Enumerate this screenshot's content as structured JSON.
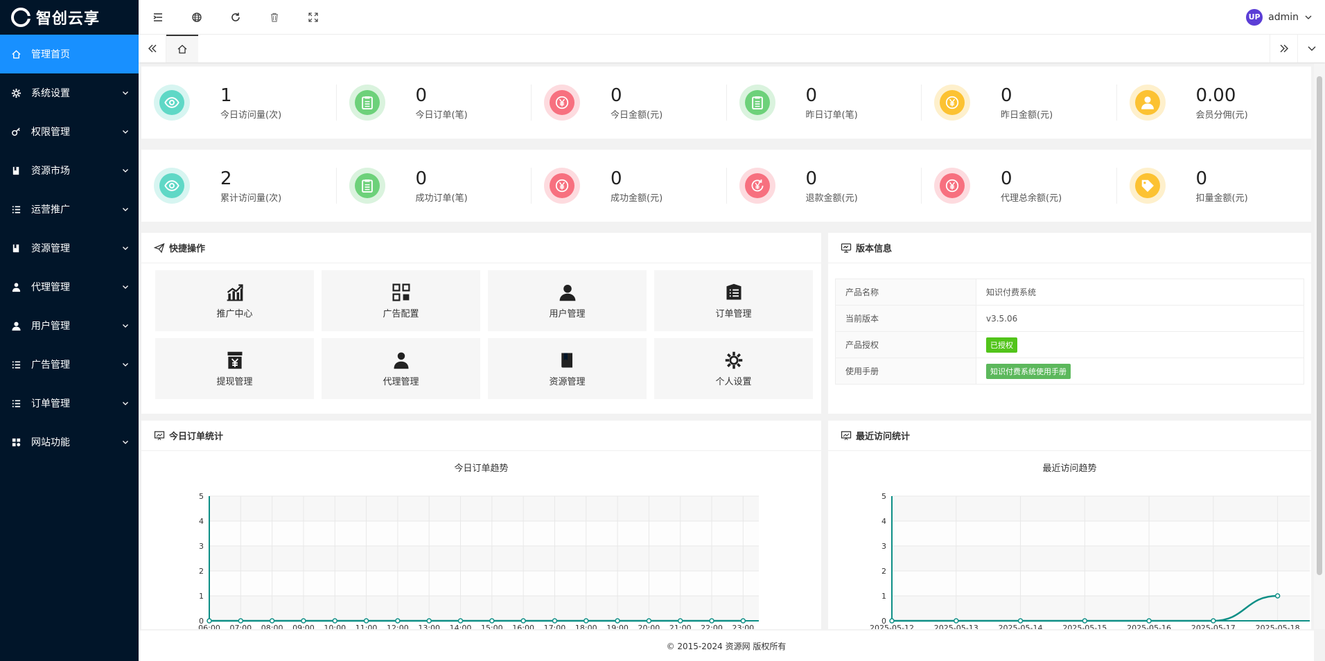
{
  "brand": {
    "name": "智创云享"
  },
  "sidebar": {
    "items": [
      {
        "label": "管理首页",
        "icon": "home-icon",
        "active": true
      },
      {
        "label": "系统设置",
        "icon": "gear-icon"
      },
      {
        "label": "权限管理",
        "icon": "key-icon"
      },
      {
        "label": "资源市场",
        "icon": "book-icon"
      },
      {
        "label": "运营推广",
        "icon": "list-icon"
      },
      {
        "label": "资源管理",
        "icon": "book-icon"
      },
      {
        "label": "代理管理",
        "icon": "agent-icon"
      },
      {
        "label": "用户管理",
        "icon": "user-icon"
      },
      {
        "label": "广告管理",
        "icon": "list-icon"
      },
      {
        "label": "订单管理",
        "icon": "list-icon"
      },
      {
        "label": "网站功能",
        "icon": "grid-icon"
      }
    ]
  },
  "header": {
    "user": "admin",
    "avatar_text": "UP"
  },
  "stats_row1": [
    {
      "value": "1",
      "label": "今日访问量(次)",
      "icon": "eye-icon",
      "color": "#5fd8c6"
    },
    {
      "value": "0",
      "label": "今日订单(笔)",
      "icon": "clipboard-icon",
      "color": "#6dd17a"
    },
    {
      "value": "0",
      "label": "今日金额(元)",
      "icon": "yuan-icon",
      "color": "#f7707f"
    },
    {
      "value": "0",
      "label": "昨日订单(笔)",
      "icon": "clipboard-icon",
      "color": "#6dd17a"
    },
    {
      "value": "0",
      "label": "昨日金额(元)",
      "icon": "yuan-icon",
      "color": "#fcc232"
    },
    {
      "value": "0.00",
      "label": "会员分佣(元)",
      "icon": "user-icon",
      "color": "#fcc232"
    }
  ],
  "stats_row2": [
    {
      "value": "2",
      "label": "累计访问量(次)",
      "icon": "eye-icon",
      "color": "#5fd8c6"
    },
    {
      "value": "0",
      "label": "成功订单(笔)",
      "icon": "clipboard-icon",
      "color": "#6dd17a"
    },
    {
      "value": "0",
      "label": "成功金额(元)",
      "icon": "yuan-icon",
      "color": "#f7707f"
    },
    {
      "value": "0",
      "label": "退款金额(元)",
      "icon": "refund-icon",
      "color": "#f7707f"
    },
    {
      "value": "0",
      "label": "代理总余额(元)",
      "icon": "yuan-icon",
      "color": "#f7707f"
    },
    {
      "value": "0",
      "label": "扣量金额(元)",
      "icon": "tag-icon",
      "color": "#fcc232"
    }
  ],
  "quick": {
    "title": "快捷操作",
    "items": [
      {
        "label": "推广中心",
        "icon": "growth-chart-icon"
      },
      {
        "label": "广告配置",
        "icon": "qr-grid-icon"
      },
      {
        "label": "用户管理",
        "icon": "user-icon"
      },
      {
        "label": "订单管理",
        "icon": "order-list-icon"
      },
      {
        "label": "提现管理",
        "icon": "withdraw-icon"
      },
      {
        "label": "代理管理",
        "icon": "agent-icon"
      },
      {
        "label": "资源管理",
        "icon": "book-icon"
      },
      {
        "label": "个人设置",
        "icon": "gear-icon"
      }
    ]
  },
  "version": {
    "title": "版本信息",
    "rows": [
      {
        "key": "产品名称",
        "value": "知识付费系统"
      },
      {
        "key": "当前版本",
        "value": "v3.5.06"
      },
      {
        "key": "产品授权",
        "badge": "已授权",
        "badge_color": "#52c41a"
      },
      {
        "key": "使用手册",
        "badge": "知识付费系统使用手册",
        "badge_color": "#5cb85c"
      }
    ]
  },
  "orders_panel": {
    "title": "今日订单统计"
  },
  "visits_panel": {
    "title": "最近访问统计"
  },
  "chart_data": [
    {
      "type": "line",
      "title": "今日订单趋势",
      "categories": [
        "06:00",
        "07:00",
        "08:00",
        "09:00",
        "10:00",
        "11:00",
        "12:00",
        "13:00",
        "14:00",
        "15:00",
        "16:00",
        "17:00",
        "18:00",
        "19:00",
        "20:00",
        "21:00",
        "22:00",
        "23:00"
      ],
      "values": [
        0,
        0,
        0,
        0,
        0,
        0,
        0,
        0,
        0,
        0,
        0,
        0,
        0,
        0,
        0,
        0,
        0,
        0
      ],
      "ylim": [
        0,
        5
      ],
      "yticks": [
        "0",
        "1",
        "2",
        "3",
        "4",
        "5"
      ],
      "color": "#0e8f86"
    },
    {
      "type": "line",
      "title": "最近访问趋势",
      "categories": [
        "2025-05-12",
        "2025-05-13",
        "2025-05-14",
        "2025-05-15",
        "2025-05-16",
        "2025-05-17",
        "2025-05-18"
      ],
      "values": [
        0,
        0,
        0,
        0,
        0,
        0,
        1
      ],
      "ylim": [
        0,
        5
      ],
      "yticks": [
        "0",
        "1",
        "2",
        "3",
        "4",
        "5"
      ],
      "color": "#0e8f86"
    }
  ],
  "footer": {
    "text": "© 2015-2024 资源网 版权所有"
  }
}
